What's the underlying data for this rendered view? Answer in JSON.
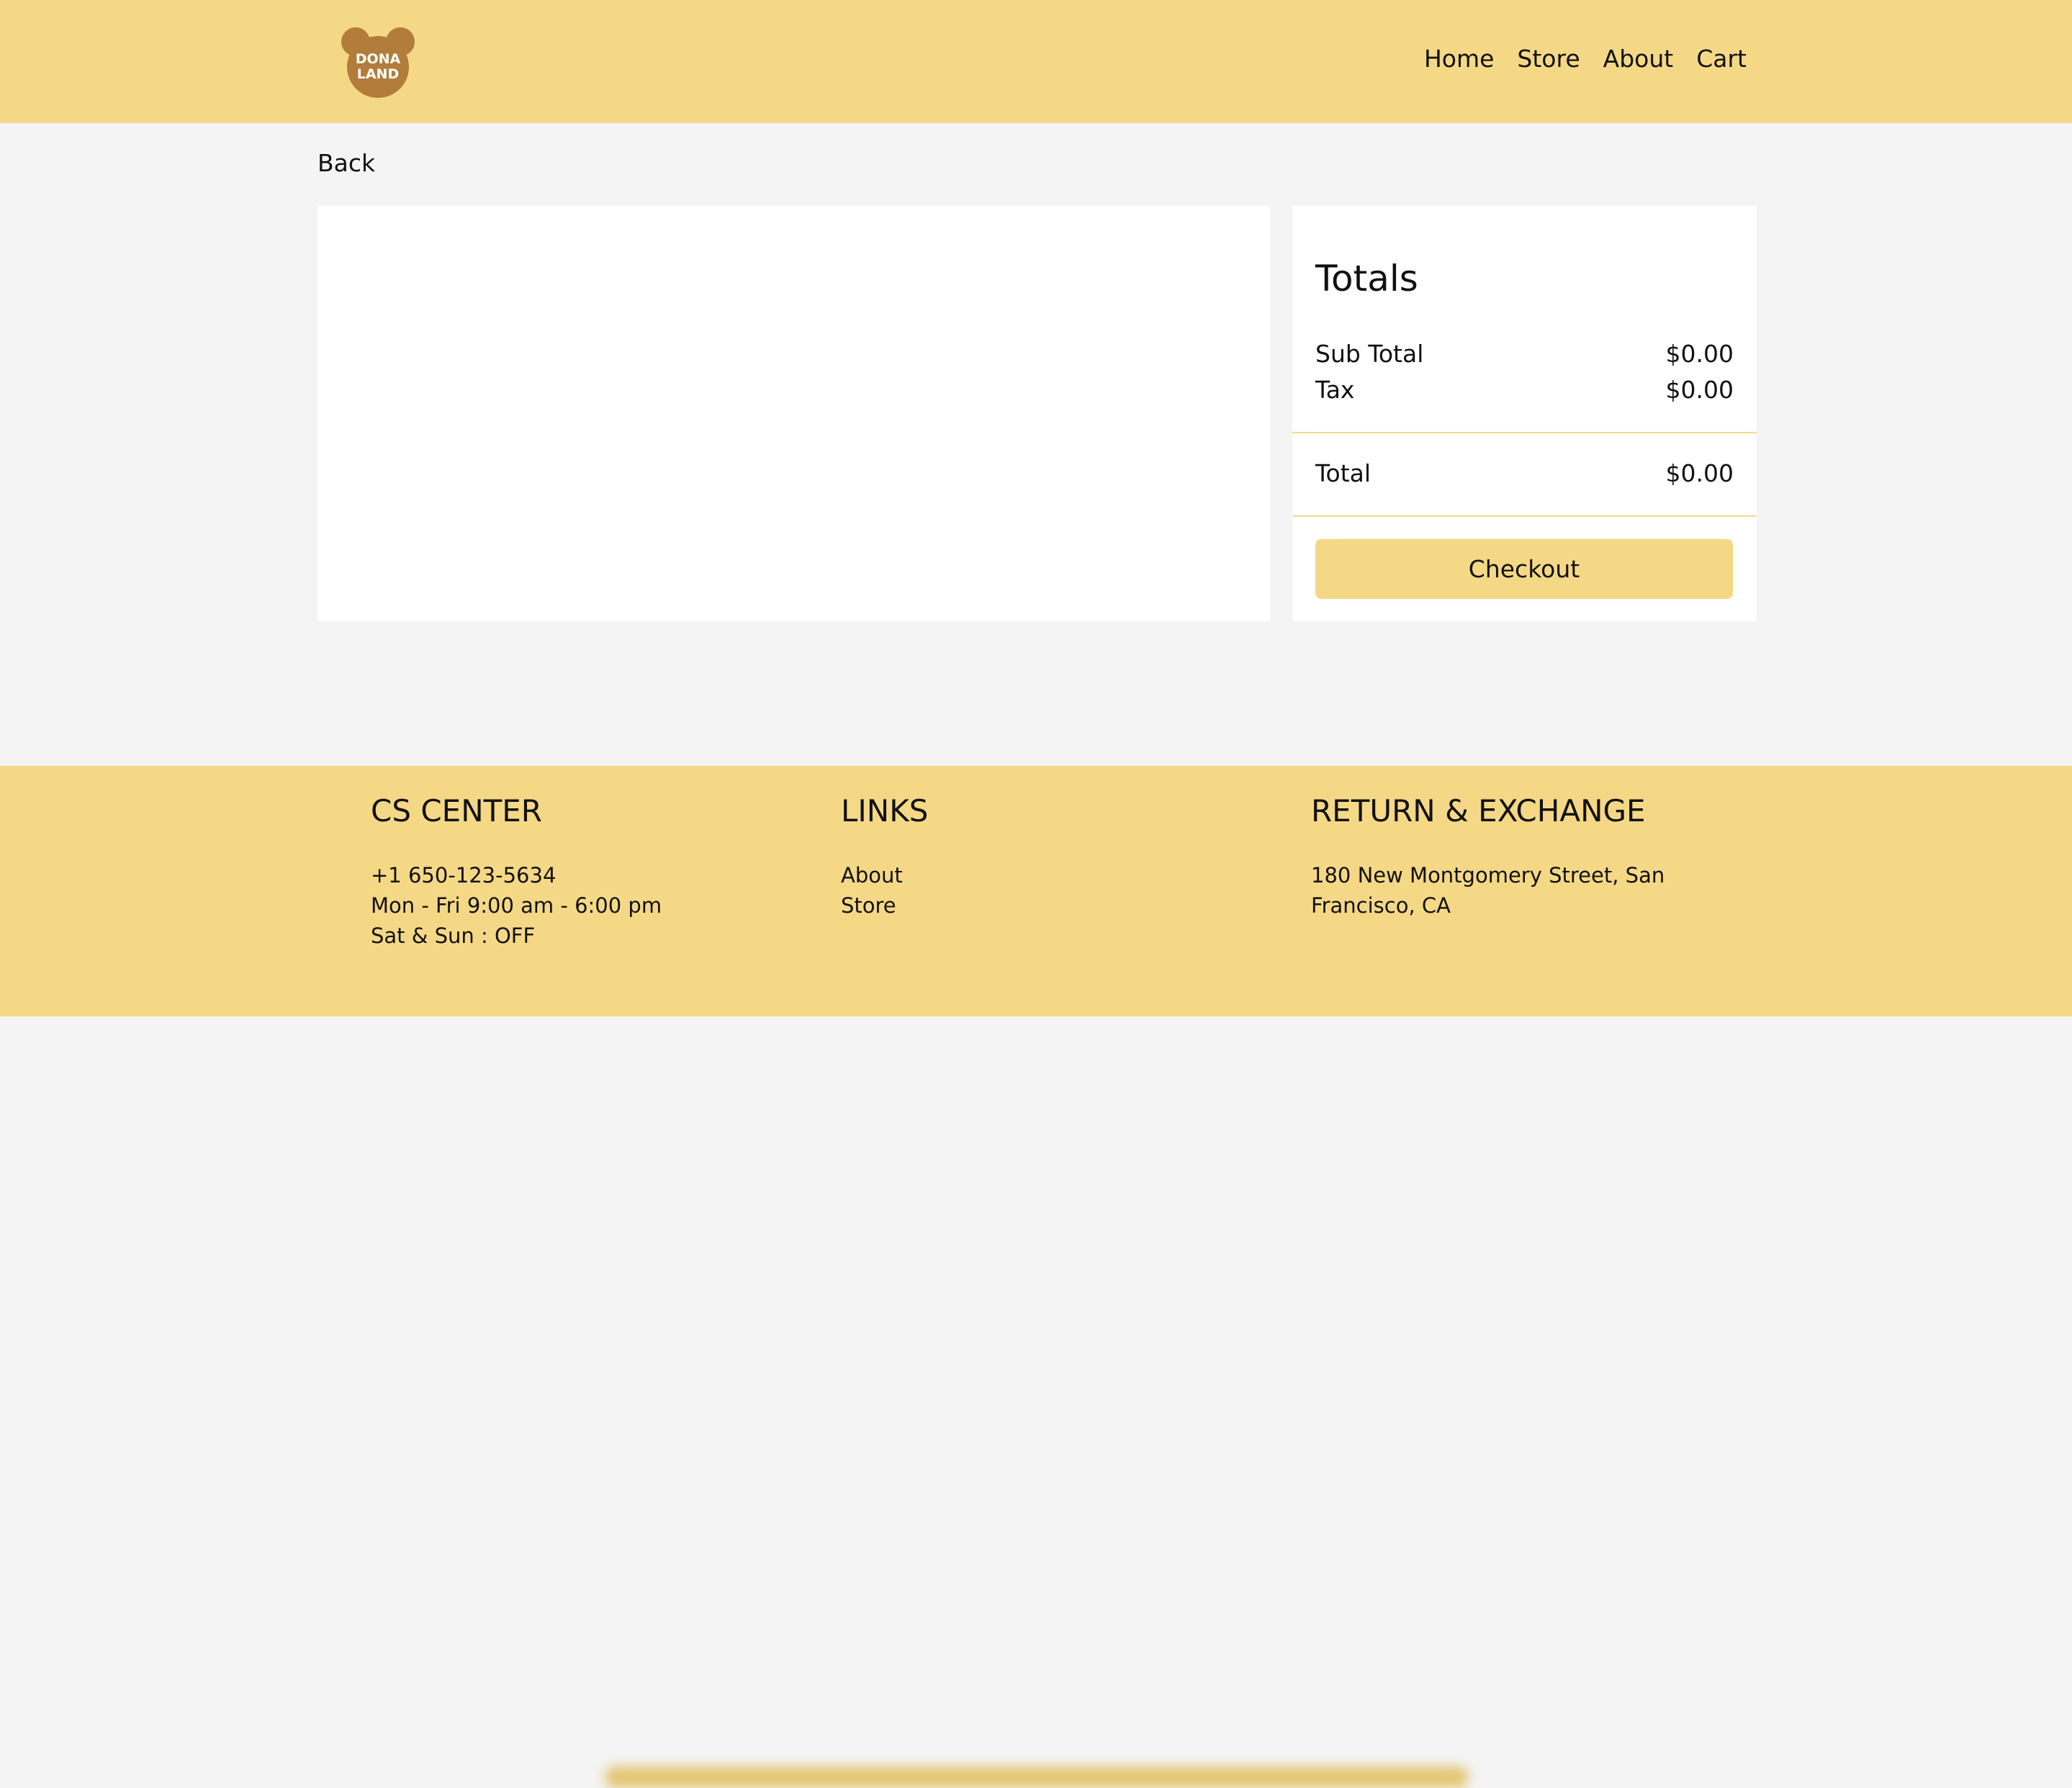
{
  "header": {
    "logo": {
      "line1": "DONA",
      "line2": "LAND"
    },
    "nav": [
      "Home",
      "Store",
      "About",
      "Cart"
    ]
  },
  "back_label": "Back",
  "totals": {
    "title": "Totals",
    "subtotal_label": "Sub Total",
    "subtotal_value": "$0.00",
    "tax_label": "Tax",
    "tax_value": "$0.00",
    "total_label": "Total",
    "total_value": "$0.00",
    "checkout_label": "Checkout"
  },
  "footer": {
    "cs": {
      "title": "CS CENTER",
      "lines": [
        "+1 650-123-5634",
        "Mon - Fri 9:00 am - 6:00 pm",
        "Sat & Sun : OFF"
      ]
    },
    "links": {
      "title": "LINKS",
      "items": [
        "About",
        "Store"
      ]
    },
    "return": {
      "title": "RETURN & EXCHANGE",
      "lines": [
        "180 New Montgomery Street, San",
        "Francisco, CA"
      ]
    }
  },
  "colors": {
    "accent": "#f5d886",
    "logo": "#b27d3a",
    "background": "#f4f4f4"
  }
}
